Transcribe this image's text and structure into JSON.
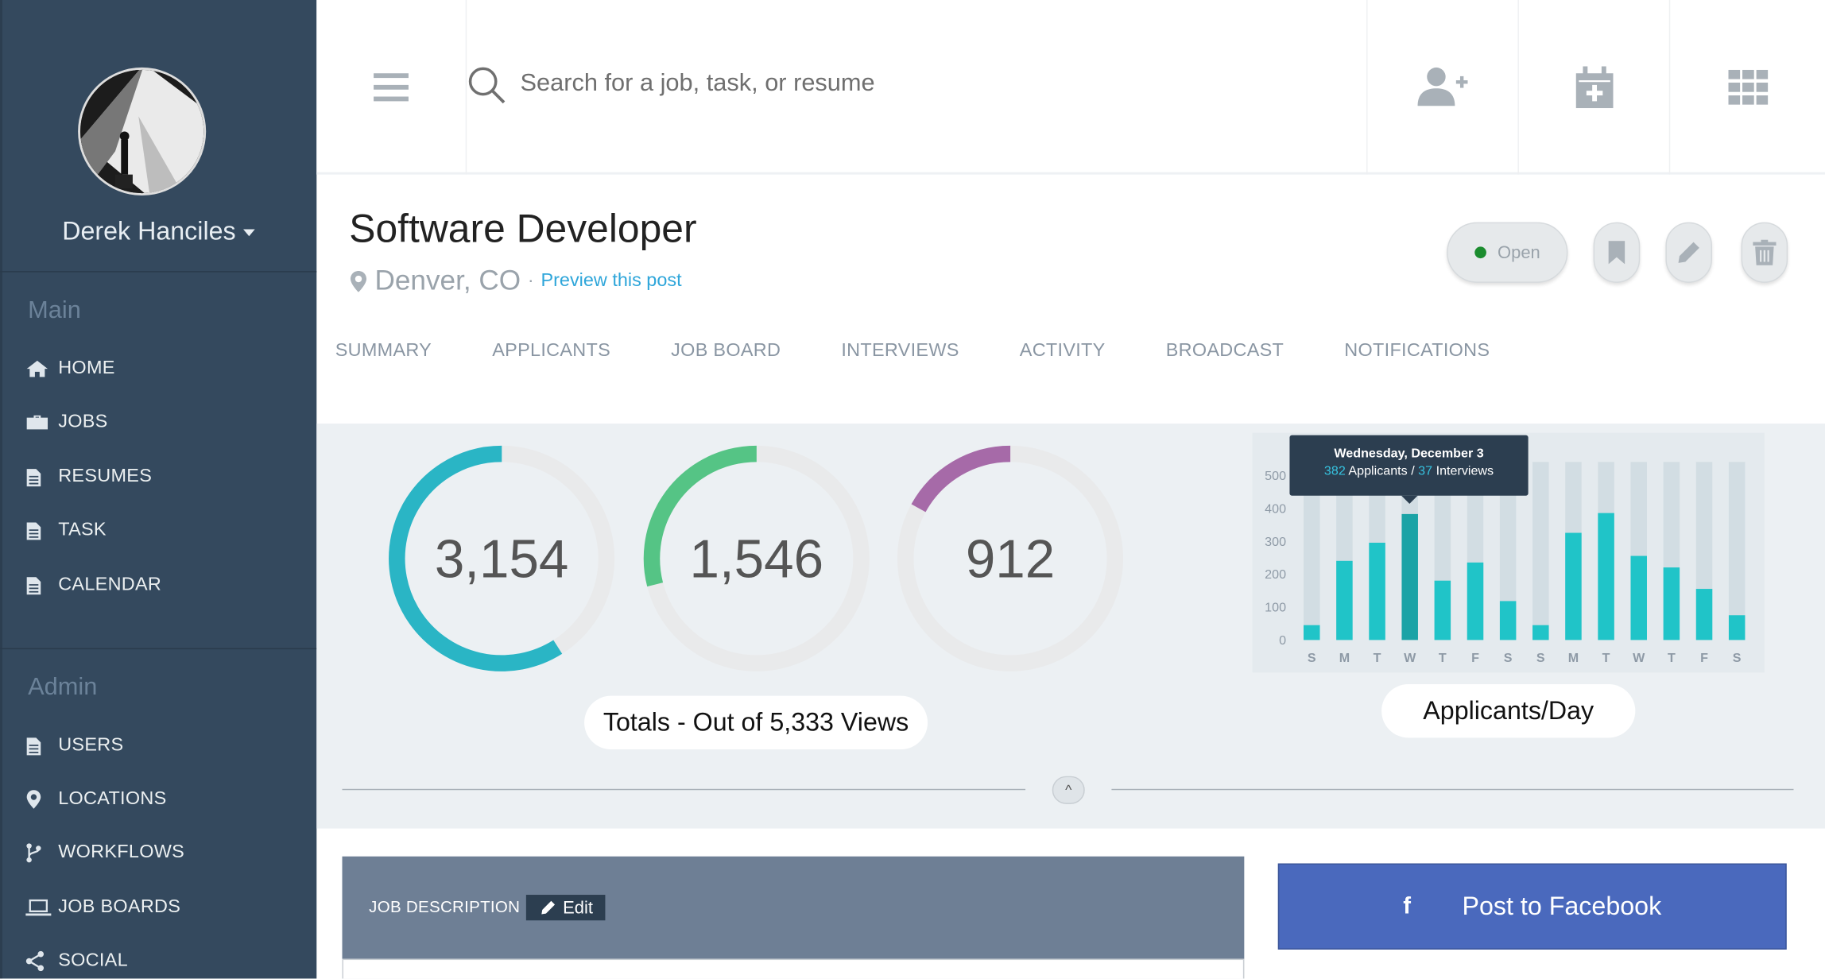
{
  "user": {
    "name": "Derek Hanciles"
  },
  "sidebar": {
    "main_title": "Main",
    "main_items": [
      {
        "label": "HOME",
        "icon": "home-icon"
      },
      {
        "label": "JOBS",
        "icon": "briefcase-icon"
      },
      {
        "label": "RESUMES",
        "icon": "document-icon"
      },
      {
        "label": "TASK",
        "icon": "document-icon"
      },
      {
        "label": "CALENDAR",
        "icon": "document-icon"
      }
    ],
    "admin_title": "Admin",
    "admin_items": [
      {
        "label": "USERS",
        "icon": "document-icon"
      },
      {
        "label": "LOCATIONS",
        "icon": "map-pin-icon"
      },
      {
        "label": "WORKFLOWS",
        "icon": "branch-icon"
      },
      {
        "label": "JOB BOARDS",
        "icon": "laptop-icon"
      },
      {
        "label": "SOCIAL",
        "icon": "share-icon"
      }
    ]
  },
  "header": {
    "search_placeholder": "Search for a job, task, or resume",
    "icons": [
      "menu-icon",
      "search-icon",
      "add-user-icon",
      "add-calendar-icon",
      "grid-icon"
    ]
  },
  "job": {
    "title": "Software Developer",
    "location": "Denver, CO",
    "preview_link": "Preview this post",
    "status": "Open"
  },
  "tabs": [
    "SUMMARY",
    "APPLICANTS",
    "JOB BOARD",
    "INTERVIEWS",
    "ACTIVITY",
    "BROADCAST",
    "NOTIFICATIONS"
  ],
  "stats": {
    "gauges": [
      {
        "value": "3,154",
        "fraction": 0.59,
        "color": "#2ab5c5"
      },
      {
        "value": "1,546",
        "fraction": 0.29,
        "color": "#55c485"
      },
      {
        "value": "912",
        "fraction": 0.17,
        "color": "#a66aa8"
      }
    ],
    "totals_label": "Totals - Out of 5,333 Views",
    "chart_label": "Applicants/Day"
  },
  "chart_data": {
    "type": "bar",
    "categories": [
      "S",
      "M",
      "T",
      "W",
      "T",
      "F",
      "S",
      "S",
      "M",
      "T",
      "W",
      "T",
      "F",
      "S"
    ],
    "values": [
      45,
      240,
      295,
      382,
      180,
      235,
      118,
      45,
      325,
      385,
      255,
      220,
      155,
      75
    ],
    "highlight_index": 3,
    "ylim": [
      0,
      540
    ],
    "yticks": [
      0,
      100,
      200,
      300,
      400,
      500
    ],
    "bar_color": "#20c4c8",
    "highlight_color": "#1aa3a6",
    "track_color": "#d2dde3",
    "tooltip": {
      "date": "Wednesday, December 3",
      "applicants_value": "382",
      "applicants_label": "Applicants",
      "separator": "/",
      "interviews_value": "37",
      "interviews_label": "Interviews"
    }
  },
  "job_description": {
    "label": "JOB DESCRIPTION",
    "edit_label": "Edit"
  },
  "facebook": {
    "label": "Post to Facebook"
  }
}
